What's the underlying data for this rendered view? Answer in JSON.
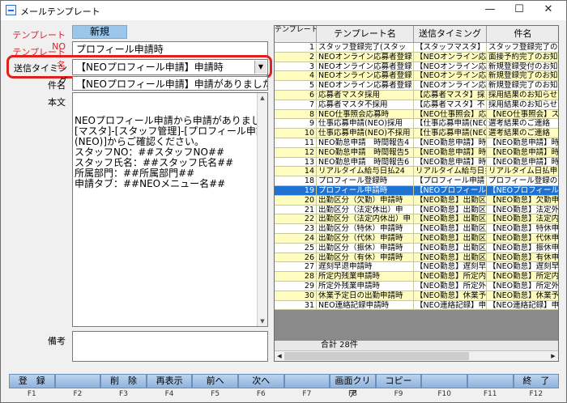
{
  "window": {
    "title": "メールテンプレート",
    "minimize": "—",
    "maximize": "☐",
    "close": "✕"
  },
  "form": {
    "template_no_label": "テンプレートNO",
    "template_no_value": "新規",
    "template_name_label": "テンプレート名",
    "template_name_value": "プロフィール申請時",
    "send_timing_label": "送信タイミング",
    "send_timing_value": "【NEOプロフィール申請】申請時",
    "subject_label": "件名",
    "subject_value": "【NEOプロフィール申請】申請がありました",
    "body_label": "本文",
    "body_value": "NEOプロフィール申請から申請がありました。\n[マスタ]-[スタッフ管理]-[プロフィール申請\n(NEO)]からご確認ください。\nスタッフNO：##スタッフNO##\nスタッフ氏名：##スタッフ氏名##\n所属部門：##所属部門##\n申請タブ：##NEOメニュー名##",
    "remarks_label": "備考",
    "remarks_value": ""
  },
  "grid": {
    "headers": [
      "テンプレートNO",
      "テンプレート名",
      "送信タイミング",
      "件名"
    ],
    "rows": [
      {
        "no": "1",
        "name": "スタッフ登録完了(スタッ",
        "timing": "【スタッフマスタ】",
        "subject": "スタッフ登録完了のお",
        "style": "w"
      },
      {
        "no": "2",
        "name": "NEOオンライン応募者登録",
        "timing": "【NEOオンライン応",
        "subject": "面接予約完了のお知",
        "style": "y"
      },
      {
        "no": "3",
        "name": "NEOオンライン応募者登録",
        "timing": "【NEOオンライン応",
        "subject": "新規登録受付のお知",
        "style": "w"
      },
      {
        "no": "4",
        "name": "NEOオンライン応募者登録",
        "timing": "【NEOオンライン応",
        "subject": "新規登録完了のお知",
        "style": "y"
      },
      {
        "no": "5",
        "name": "NEOオンライン応募者登録",
        "timing": "【NEOオンライン応",
        "subject": "新規登録完了のお知",
        "style": "w"
      },
      {
        "no": "6",
        "name": "応募者マスタ採用",
        "timing": "【応募者マスタ】採",
        "subject": "採用結果のお知らせ",
        "style": "y"
      },
      {
        "no": "7",
        "name": "応募者マスタ不採用",
        "timing": "【応募者マスタ】不",
        "subject": "採用結果のお知らせ",
        "style": "w"
      },
      {
        "no": "8",
        "name": "NEO仕事照会応募時",
        "timing": "【NEO仕事照会】応募",
        "subject": "【NEO仕事照会】ス",
        "style": "y"
      },
      {
        "no": "9",
        "name": "仕事応募申請(NEO)採用",
        "timing": "【仕事応募申請(NEO",
        "subject": "選考結果のご連絡",
        "style": "w"
      },
      {
        "no": "10",
        "name": "仕事応募申請(NEO)不採用",
        "timing": "【仕事応募申請(NEO",
        "subject": "選考結果のご連絡",
        "style": "y"
      },
      {
        "no": "11",
        "name": "NEO勤怠申請　時間報告4",
        "timing": "【NEO勤怠申請】時間",
        "subject": "【NEO勤怠申請】時",
        "style": "w"
      },
      {
        "no": "12",
        "name": "NEO勤怠申請　時間報告5",
        "timing": "【NEO勤怠申請】時間",
        "subject": "【NEO勤怠申請】時",
        "style": "y"
      },
      {
        "no": "13",
        "name": "NEO勤怠申請　時間報告6",
        "timing": "【NEO勤怠申請】時間",
        "subject": "【NEO勤怠申請】時",
        "style": "w"
      },
      {
        "no": "14",
        "name": "リアルタイム給与日払24",
        "timing": "リアルタイム給与日払",
        "subject": "リアルタイム日払申",
        "style": "y"
      },
      {
        "no": "18",
        "name": "プロフィール登録時",
        "timing": "【プロフィール申請",
        "subject": "プロフィール登録の",
        "style": "w"
      },
      {
        "no": "19",
        "name": "プロフィール申請時",
        "timing": "【NEOプロフィール申",
        "subject": "【NEOプロフィール申",
        "style": "sel"
      },
      {
        "no": "20",
        "name": "出勤区分（欠勤）申請時",
        "timing": "【NEO勤怠】出勤区分",
        "subject": "【NEO勤怠】欠勤申",
        "style": "y"
      },
      {
        "no": "21",
        "name": "出勤区分（法定休出）申",
        "timing": "【NEO勤怠】出勤区分",
        "subject": "【NEO勤怠】法定外休",
        "style": "w"
      },
      {
        "no": "22",
        "name": "出勤区分（法定内休出）申",
        "timing": "【NEO勤怠】出勤区分",
        "subject": "【NEO勤怠】法定内休",
        "style": "y"
      },
      {
        "no": "23",
        "name": "出勤区分（特休）申請時",
        "timing": "【NEO勤怠】出勤区分",
        "subject": "【NEO勤怠】特休申",
        "style": "w"
      },
      {
        "no": "24",
        "name": "出勤区分（代休）申請時",
        "timing": "【NEO勤怠】出勤区分",
        "subject": "【NEO勤怠】代休申",
        "style": "y"
      },
      {
        "no": "25",
        "name": "出勤区分（振休）申請時",
        "timing": "【NEO勤怠】出勤区分",
        "subject": "【NEO勤怠】振休申",
        "style": "w"
      },
      {
        "no": "26",
        "name": "出勤区分（有休）申請時",
        "timing": "【NEO勤怠】出勤区分",
        "subject": "【NEO勤怠】有休申",
        "style": "y"
      },
      {
        "no": "27",
        "name": "遅刻早退申請時",
        "timing": "【NEO勤怠】遅刻早退",
        "subject": "【NEO勤怠】遅刻早退",
        "style": "w"
      },
      {
        "no": "28",
        "name": "所定内残業申請時",
        "timing": "【NEO勤怠】所定内残",
        "subject": "【NEO勤怠】所定内残",
        "style": "y"
      },
      {
        "no": "29",
        "name": "所定外残業申請時",
        "timing": "【NEO勤怠】所定外残",
        "subject": "【NEO勤怠】所定外残",
        "style": "w"
      },
      {
        "no": "30",
        "name": "休業予定日の出勤申請時",
        "timing": "【NEO勤怠】休業予定",
        "subject": "【NEO勤怠】休業予定",
        "style": "y"
      },
      {
        "no": "31",
        "name": "NEO連絡記録申請時",
        "timing": "【NEO連絡記録】申請",
        "subject": "【NEO連絡記録】申請",
        "style": "w"
      }
    ],
    "total": "合計 28件"
  },
  "function_keys": [
    {
      "label": "登　録",
      "key": "F1"
    },
    {
      "label": "",
      "key": "F2"
    },
    {
      "label": "削　除",
      "key": "F3"
    },
    {
      "label": "再表示",
      "key": "F4"
    },
    {
      "label": "前へ",
      "key": "F5"
    },
    {
      "label": "次へ",
      "key": "F6"
    },
    {
      "label": "",
      "key": "F7"
    },
    {
      "label": "画面クリア",
      "key": "F8"
    },
    {
      "label": "コピー",
      "key": "F9"
    },
    {
      "label": "",
      "key": "F10"
    },
    {
      "label": "",
      "key": "F11"
    },
    {
      "label": "終　了",
      "key": "F12"
    }
  ],
  "colors": {
    "accent_red": "#d8232a",
    "selected_row": "#1e73d2",
    "yellow_row": "#fffcc0",
    "fkey_blue": "#a4c3e5"
  }
}
